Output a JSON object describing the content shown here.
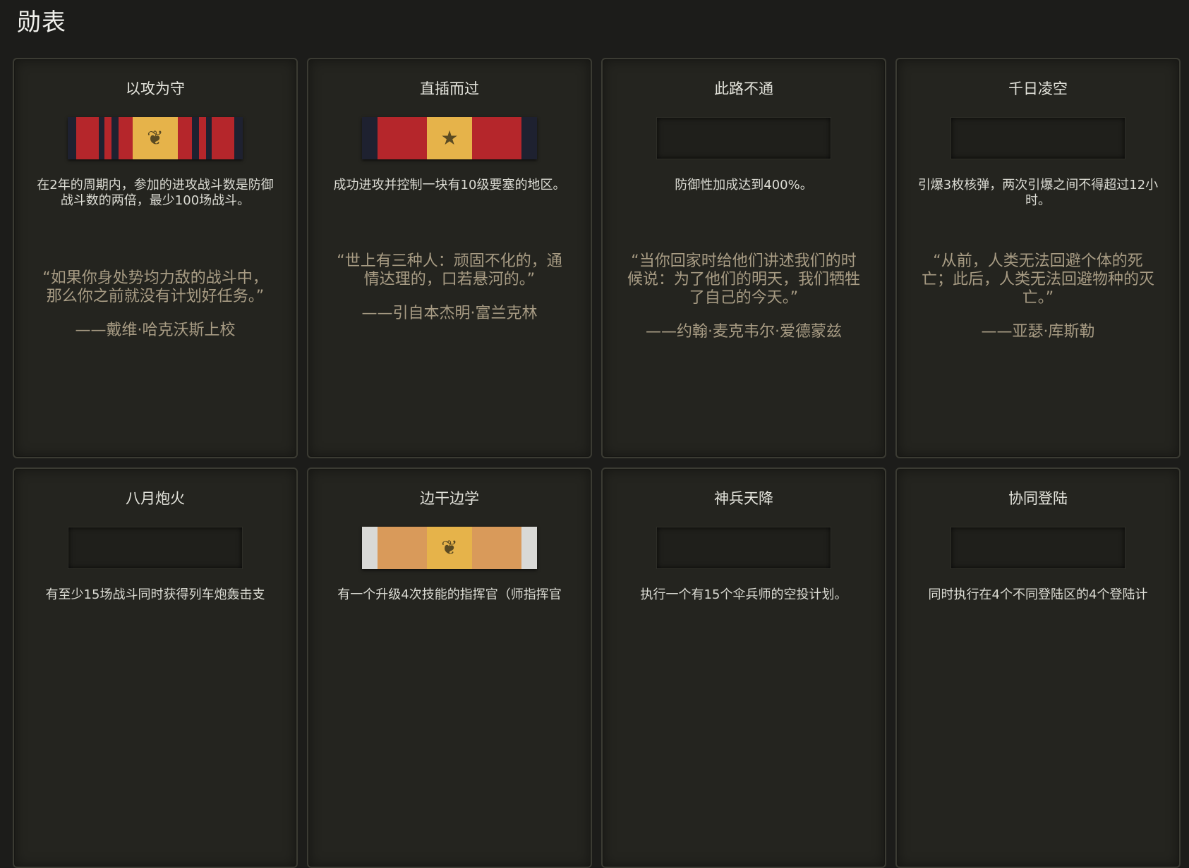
{
  "page": {
    "title": "勋表"
  },
  "cards": [
    {
      "title": "以攻为守",
      "ribbon": "striped-red-gold-leaf",
      "description": "在2年的周期内，参加的进攻战斗数是防御战斗数的两倍，最少100场战斗。",
      "quote": "“如果你身处势均力敌的战斗中，那么你之前就没有计划好任务。”",
      "author": "——戴维·哈克沃斯上校"
    },
    {
      "title": "直插而过",
      "ribbon": "red-gold-star",
      "description": "成功进攻并控制一块有10级要塞的地区。",
      "quote": "“世上有三种人：顽固不化的，通情达理的，口若悬河的。”",
      "author": "——引自本杰明·富兰克林"
    },
    {
      "title": "此路不通",
      "ribbon": "locked",
      "description": "防御性加成达到400%。",
      "quote": "“当你回家时给他们讲述我们的时候说：为了他们的明天，我们牺牲了自己的今天。”",
      "author": "——约翰·麦克韦尔·爱德蒙兹"
    },
    {
      "title": "千日凌空",
      "ribbon": "locked",
      "description": "引爆3枚核弹，两次引爆之间不得超过12小时。",
      "quote": "“从前，人类无法回避个体的死亡；此后，人类无法回避物种的灭亡。”",
      "author": "——亚瑟·库斯勒"
    },
    {
      "title": "八月炮火",
      "ribbon": "locked",
      "description": "有至少15场战斗同时获得列车炮轰击支",
      "quote": "",
      "author": ""
    },
    {
      "title": "边干边学",
      "ribbon": "orange-white-leaf",
      "description": "有一个升级4次技能的指挥官（师指挥官",
      "quote": "",
      "author": ""
    },
    {
      "title": "神兵天降",
      "ribbon": "locked",
      "description": "执行一个有15个伞兵师的空投计划。",
      "quote": "",
      "author": ""
    },
    {
      "title": "协同登陆",
      "ribbon": "locked",
      "description": "同时执行在4个不同登陆区的4个登陆计",
      "quote": "",
      "author": ""
    }
  ]
}
